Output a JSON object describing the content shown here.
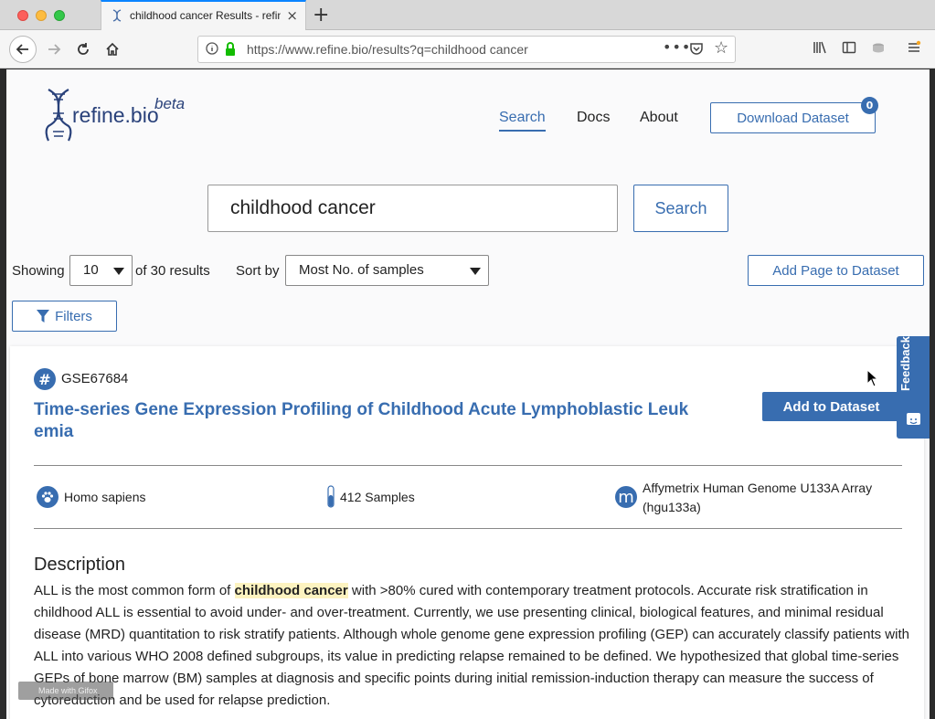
{
  "browser": {
    "tab_title": "childhood cancer Results - refine.bio",
    "tab_close": "×",
    "new_tab": "+",
    "url": "https://www.refine.bio/results?q=childhood cancer",
    "url_more": "•••"
  },
  "header": {
    "logo_text": "refine.bio",
    "logo_beta": "beta",
    "nav": {
      "search": "Search",
      "docs": "Docs",
      "about": "About"
    },
    "download_label": "Download Dataset",
    "download_count": "0"
  },
  "search": {
    "query": "childhood cancer",
    "button": "Search"
  },
  "controls": {
    "showing_label": "Showing",
    "page_size": "10",
    "results_text": "of 30 results",
    "sort_label": "Sort by",
    "sort_value": "Most No. of samples",
    "add_page_label": "Add Page to Dataset",
    "filters_label": "Filters"
  },
  "result": {
    "accession": "GSE67684",
    "title": "Time-series Gene Expression Profiling of Childhood Acute Lymphoblastic Leukemia",
    "add_label": "Add to Dataset",
    "organism": "Homo sapiens",
    "samples": "412 Samples",
    "platform": "Affymetrix Human Genome U133A Array (hgu133a)",
    "platform_icon_letter": "m",
    "description_heading": "Description",
    "description_before": "ALL is the most common form of ",
    "description_highlight": "childhood cancer",
    "description_after": " with >80% cured with contemporary treatment protocols. Accurate risk stratification in childhood ALL is essential to avoid under- and over-treatment. Currently, we use presenting clinical, biological features, and minimal residual disease (MRD) quantitation to risk stratify patients. Although whole genome gene expression profiling (GEP) can accurately classify patients with ALL into various WHO 2008 defined subgroups, its value in predicting relapse remained to be defined. We hypothesized that global time-series GEPs of bone marrow (BM) samples at diagnosis and specific points during initial remission-induction therapy can measure the success of cytoreduction and be used for relapse prediction."
  },
  "feedback_label": "Feedback",
  "watermark": "Made with Gifox",
  "colors": {
    "accent": "#386db0",
    "logo": "#29417a",
    "highlight": "#fdf3c0"
  }
}
